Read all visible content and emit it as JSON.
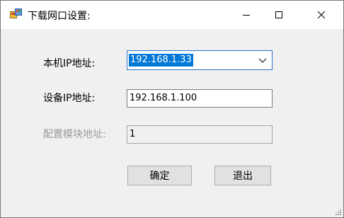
{
  "window": {
    "title": "下载网口设置:"
  },
  "fields": {
    "local_ip_label": "本机IP地址:",
    "local_ip_value": "192.168.1.33",
    "device_ip_label": "设备IP地址:",
    "device_ip_value": "192.168.1.100",
    "config_module_label": "配置模块地址:",
    "config_module_value": "1"
  },
  "buttons": {
    "confirm": "确定",
    "exit": "退出"
  },
  "icons": {
    "app": "app-icon",
    "minimize": "minimize-icon",
    "maximize": "maximize-icon",
    "close": "close-icon",
    "dropdown": "chevron-down-icon",
    "resize": "resize-grip-icon"
  },
  "colors": {
    "selection": "#0078d7",
    "focus_border": "#2b6fc6",
    "disabled_text": "#9a9a9a"
  }
}
